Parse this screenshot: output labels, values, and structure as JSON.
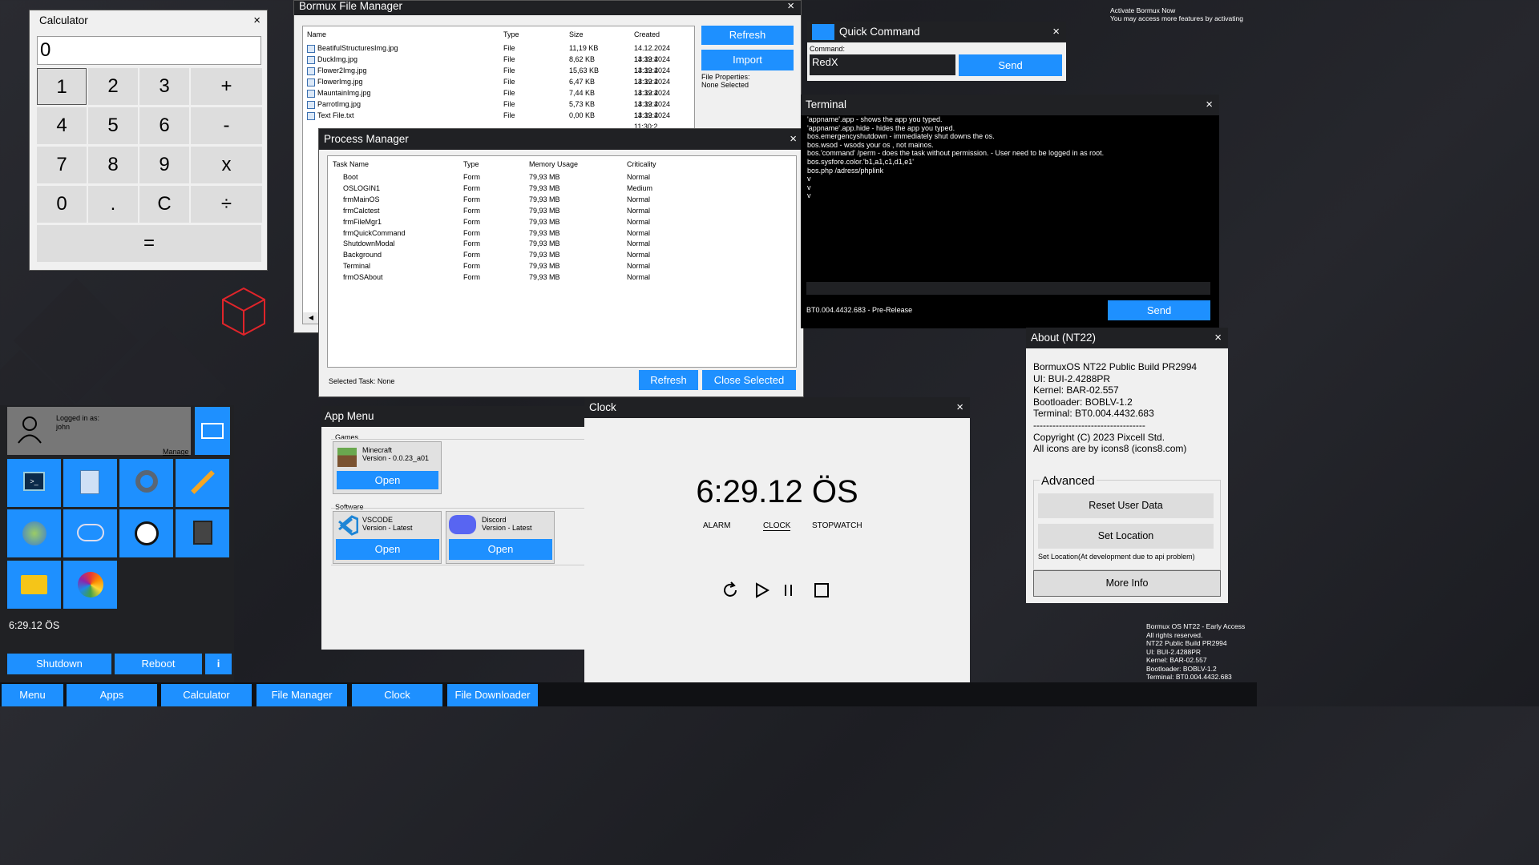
{
  "calculator": {
    "title": "Calculator",
    "close": "×",
    "display": "0",
    "keys": [
      "1",
      "2",
      "3",
      "+",
      "4",
      "5",
      "6",
      "-",
      "7",
      "8",
      "9",
      "x",
      "0",
      ".",
      "C",
      "÷",
      "="
    ]
  },
  "file_manager": {
    "title": "Bormux File Manager",
    "close": "×",
    "columns": [
      "Name",
      "Type",
      "Size",
      "Created"
    ],
    "rows": [
      {
        "name": "BeatifulStructuresImg.jpg",
        "type": "File",
        "size": "11,19 KB",
        "created": "14.12.2024 13:39:4"
      },
      {
        "name": "DuckImg.jpg",
        "type": "File",
        "size": "8,62 KB",
        "created": "14.12.2024 13:39:4"
      },
      {
        "name": "Flower2Img.jpg",
        "type": "File",
        "size": "15,63 KB",
        "created": "14.12.2024 13:39:4"
      },
      {
        "name": "FlowerImg.jpg",
        "type": "File",
        "size": "6,47 KB",
        "created": "14.12.2024 13:39:4"
      },
      {
        "name": "MauntainImg.jpg",
        "type": "File",
        "size": "7,44 KB",
        "created": "14.12.2024 13:39:4"
      },
      {
        "name": "ParrotImg.jpg",
        "type": "File",
        "size": "5,73 KB",
        "created": "14.12.2024 13:39:4"
      },
      {
        "name": "Text File.txt",
        "type": "File",
        "size": "0,00 KB",
        "created": "14.12.2024 11:30:2"
      }
    ],
    "refresh": "Refresh",
    "import": "Import",
    "props_label": "File Properties:",
    "props_value": "None Selected",
    "scroll_left": "◀"
  },
  "process_manager": {
    "title": "Process Manager",
    "close": "×",
    "columns": [
      "Task Name",
      "Type",
      "Memory Usage",
      "Criticality"
    ],
    "rows": [
      {
        "name": "Boot",
        "type": "Form",
        "mem": "79,93 MB",
        "crit": "Normal"
      },
      {
        "name": "OSLOGIN1",
        "type": "Form",
        "mem": "79,93 MB",
        "crit": "Medium"
      },
      {
        "name": "frmMainOS",
        "type": "Form",
        "mem": "79,93 MB",
        "crit": "Normal"
      },
      {
        "name": "frmCalctest",
        "type": "Form",
        "mem": "79,93 MB",
        "crit": "Normal"
      },
      {
        "name": "frmFileMgr1",
        "type": "Form",
        "mem": "79,93 MB",
        "crit": "Normal"
      },
      {
        "name": "frmQuickCommand",
        "type": "Form",
        "mem": "79,93 MB",
        "crit": "Normal"
      },
      {
        "name": "ShutdownModal",
        "type": "Form",
        "mem": "79,93 MB",
        "crit": "Normal"
      },
      {
        "name": "Background",
        "type": "Form",
        "mem": "79,93 MB",
        "crit": "Normal"
      },
      {
        "name": "Terminal",
        "type": "Form",
        "mem": "79,93 MB",
        "crit": "Normal"
      },
      {
        "name": "frmOSAbout",
        "type": "Form",
        "mem": "79,93 MB",
        "crit": "Normal"
      }
    ],
    "selected": "Selected Task: None",
    "refresh": "Refresh",
    "close_selected": "Close Selected"
  },
  "quick_command": {
    "title": "Quick Command",
    "close": "×",
    "label": "Command:",
    "value": "RedX",
    "send": "Send"
  },
  "terminal": {
    "title": "Terminal",
    "close": "×",
    "lines": [
      "'appname'.app - shows the app you typed.",
      "'appname'.app.hide - hides the app you typed.",
      "bos.emergencyshutdown - immediately shut downs the os.",
      "bos.wsod - wsods your os , not mainos.",
      "bos.'command' /perm - does the task without permission. - User need to be logged in as root.",
      "bos.sysfore.color.'b1,a1,c1,d1,e1'",
      "bos.php /adress/phplink",
      "v",
      "v",
      "v"
    ],
    "version": "BT0.004.4432.683 - Pre-Release",
    "send": "Send"
  },
  "activate": {
    "line1": "Activate Bormux Now",
    "line2": "You may access more features by activating"
  },
  "about": {
    "title": "About (NT22)",
    "close": "×",
    "lines": [
      "BormuxOS NT22 Public Build PR2994",
      "UI: BUI-2.4288PR",
      "Kernel: BAR-02.557",
      "Bootloader: BOBLV-1.2",
      "Terminal: BT0.004.4432.683",
      "-----------------------------------",
      "Copyright (C) 2023 Pixcell Std.",
      "All icons are by icons8 (icons8.com)"
    ],
    "advanced": "Advanced",
    "reset": "Reset User Data",
    "set_location": "Set Location",
    "note": "Set Location(At development due to api problem)",
    "more_info": "More Info"
  },
  "app_menu": {
    "title": "App Menu",
    "games": "Games",
    "software": "Software",
    "minecraft": {
      "name": "Minecraft",
      "version": "Version - 0.0.23_a01",
      "open": "Open"
    },
    "vscode": {
      "name": "VSCODE",
      "version": "Version - Latest",
      "open": "Open"
    },
    "discord": {
      "name": "Discord",
      "version": "Version - Latest",
      "open": "Open"
    }
  },
  "clock": {
    "title": "Clock",
    "close": "×",
    "time": "6:29.12 ÖS",
    "alarm": "ALARM",
    "clock": "CLOCK",
    "stopwatch": "STOPWATCH"
  },
  "start_menu": {
    "logged_in": "Logged in as:",
    "user": "john",
    "manage": "Manage",
    "time": "6:29.12 ÖS",
    "shutdown": "Shutdown",
    "reboot": "Reboot",
    "info": "i"
  },
  "taskbar": [
    "Menu",
    "Apps",
    "Calculator",
    "File Manager",
    "Clock",
    "File Downloader"
  ],
  "build_info": [
    "Bormux OS NT22 - Early Access",
    "All rights reserved.",
    "NT22 Public Build PR2994",
    "UI: BUI-2.4288PR",
    "Kernel: BAR-02.557",
    "Bootloader: BOBLV-1.2",
    "Terminal: BT0.004.4432.683"
  ]
}
